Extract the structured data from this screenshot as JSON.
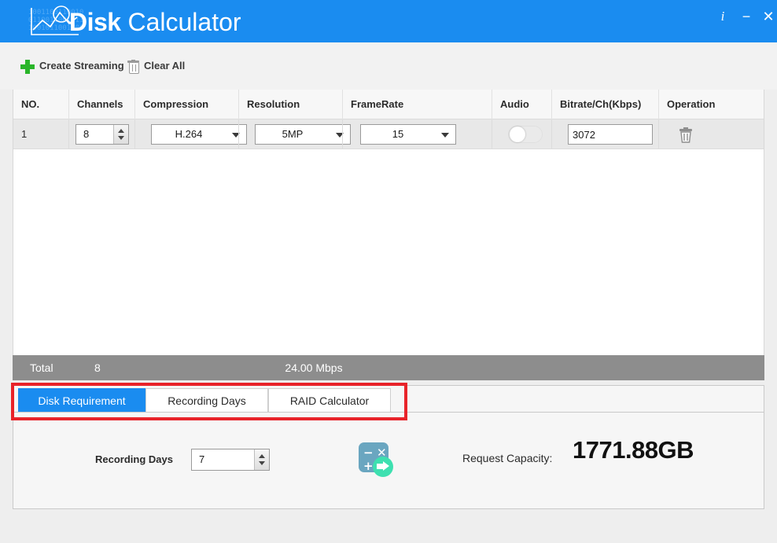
{
  "window": {
    "title_bold": "Disk",
    "title_light": " Calculator",
    "accent_color": "#1a8cf0",
    "controls": [
      {
        "name": "info",
        "glyph": "i"
      },
      {
        "name": "minimize",
        "glyph": "−"
      },
      {
        "name": "close",
        "glyph": "✕"
      }
    ]
  },
  "toolbar": {
    "create_streaming": "Create Streaming",
    "clear_all": "Clear All"
  },
  "table": {
    "headers": [
      "NO.",
      "Channels",
      "Compression",
      "Resolution",
      "FrameRate",
      "Audio",
      "Bitrate/Ch(Kbps)",
      "Operation"
    ],
    "rows": [
      {
        "no": "1",
        "channels": "8",
        "compression": "H.264",
        "resolution": "5MP",
        "framerate": "15",
        "audio_on": false,
        "bitrate": "3072"
      }
    ]
  },
  "total": {
    "label": "Total",
    "channels": "8",
    "bitrate": "24.00 Mbps"
  },
  "tabs": [
    {
      "label": "Disk Requirement",
      "active": true
    },
    {
      "label": "Recording Days",
      "active": false
    },
    {
      "label": "RAID Calculator",
      "active": false
    }
  ],
  "disk_requirement": {
    "recording_days_label": "Recording Days",
    "recording_days_value": "7",
    "calculate_icon": "calculator-go-icon",
    "request_capacity_label": "Request Capacity:",
    "request_capacity_value": "1771.88GB"
  },
  "annotation": {
    "color": "#e8232a",
    "target": "tab-bar"
  }
}
